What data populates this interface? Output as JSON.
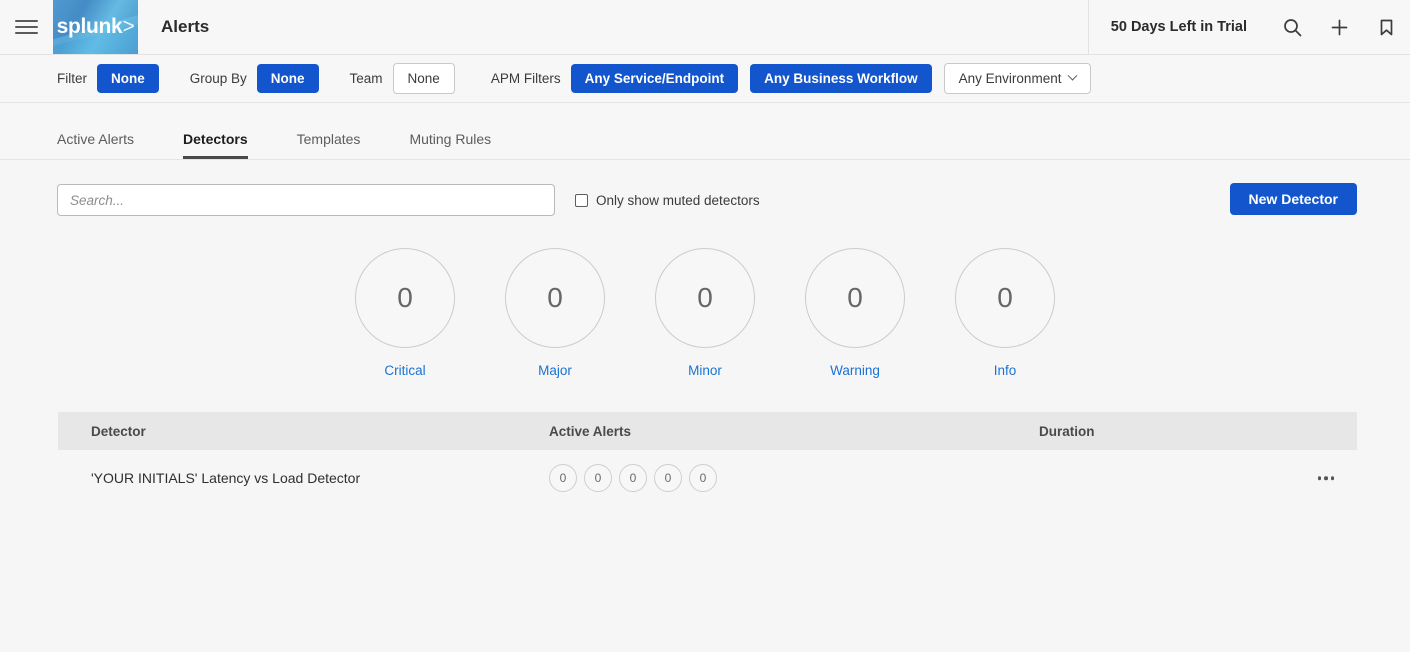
{
  "header": {
    "menu_icon": "hamburger-icon",
    "logo_text": "splunk",
    "logo_mark": ">",
    "app_title": "Alerts",
    "trial_text": "50 Days Left in Trial",
    "icons": [
      "search-icon",
      "plus-icon",
      "bookmark-icon"
    ]
  },
  "filter_bar": {
    "filter_label": "Filter",
    "filter_value": "None",
    "group_by_label": "Group By",
    "group_by_value": "None",
    "team_label": "Team",
    "team_value": "None",
    "apm_label": "APM Filters",
    "apm_service": "Any Service/Endpoint",
    "apm_workflow": "Any Business Workflow",
    "apm_environment": "Any Environment"
  },
  "tabs": [
    {
      "label": "Active Alerts",
      "active": false
    },
    {
      "label": "Detectors",
      "active": true
    },
    {
      "label": "Templates",
      "active": false
    },
    {
      "label": "Muting Rules",
      "active": false
    }
  ],
  "toolbar": {
    "search_placeholder": "Search...",
    "search_value": "",
    "muted_checkbox_label": "Only show muted detectors",
    "muted_checked": false,
    "new_detector_label": "New Detector"
  },
  "severity_summary": [
    {
      "count": "0",
      "label": "Critical"
    },
    {
      "count": "0",
      "label": "Major"
    },
    {
      "count": "0",
      "label": "Minor"
    },
    {
      "count": "0",
      "label": "Warning"
    },
    {
      "count": "0",
      "label": "Info"
    }
  ],
  "table": {
    "columns": [
      "Detector",
      "Active Alerts",
      "Duration"
    ],
    "rows": [
      {
        "detector": "'YOUR INITIALS' Latency vs Load Detector",
        "alerts": [
          "0",
          "0",
          "0",
          "0",
          "0"
        ],
        "duration": ""
      }
    ]
  },
  "colors": {
    "accent_blue": "#1255cc",
    "link_blue": "#1a73d4",
    "logo_blue": "#3a87c8",
    "page_bg": "#f6f6f6",
    "header_bg": "#f7f7f7",
    "table_header_bg": "#e7e7e7"
  }
}
